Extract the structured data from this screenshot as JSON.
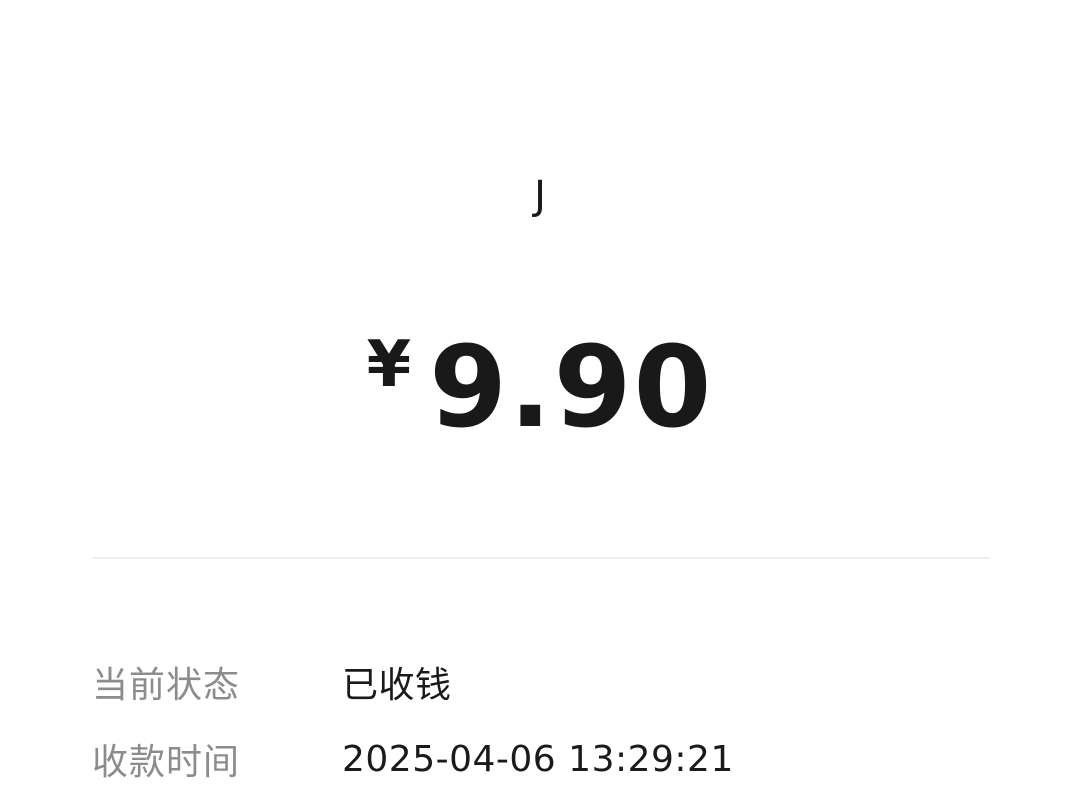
{
  "payer": {
    "name": "J"
  },
  "amount": {
    "currency": "¥",
    "value": "9.90"
  },
  "details": [
    {
      "label": "当前状态",
      "value": "已收钱"
    },
    {
      "label": "收款时间",
      "value": "2025-04-06 13:29:21"
    }
  ]
}
